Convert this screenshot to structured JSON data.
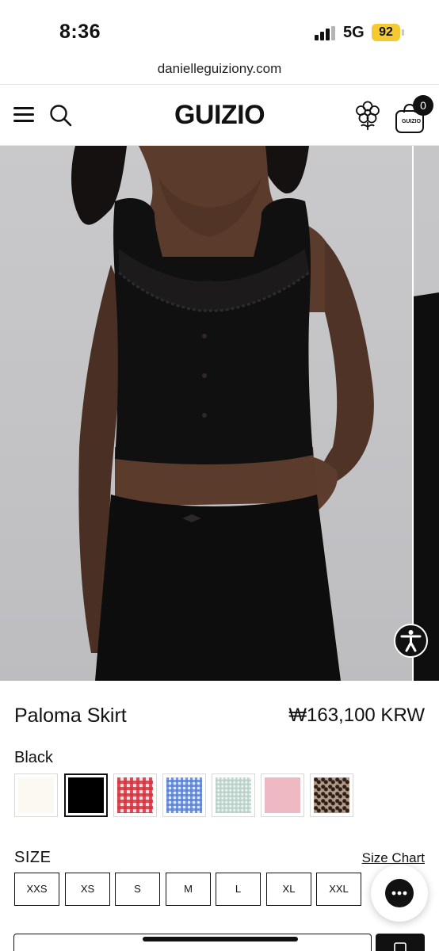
{
  "status_bar": {
    "time": "8:36",
    "network": "5G",
    "battery": "92",
    "battery_color": "#f4c932"
  },
  "browser": {
    "url": "danielleguiziony.com"
  },
  "header": {
    "logo": "GUIZIO",
    "bag_label": "GUIZIO",
    "cart_count": "0",
    "icons": [
      "menu-icon",
      "search-icon",
      "flower-icon",
      "bag-icon"
    ]
  },
  "product": {
    "title": "Paloma Skirt",
    "price": "₩163,100 KRW",
    "selected_color": "Black",
    "swatches": [
      {
        "name": "cream",
        "color": "#fbf9f2"
      },
      {
        "name": "black",
        "color": "#000000",
        "selected": true
      },
      {
        "name": "red-gingham",
        "color": "#d6333e"
      },
      {
        "name": "blue-gingham",
        "color": "#5b80cf"
      },
      {
        "name": "sage-gingham",
        "color": "#cfe0da"
      },
      {
        "name": "pink",
        "color": "#efb9c3"
      },
      {
        "name": "leopard",
        "color": "#7a6150"
      }
    ],
    "size_label": "SIZE",
    "size_chart_label": "Size Chart",
    "sizes": [
      "XXS",
      "XS",
      "S",
      "M",
      "L",
      "XL",
      "XXL"
    ]
  },
  "colors": {
    "accent": "#111111",
    "background": "#ffffff"
  }
}
